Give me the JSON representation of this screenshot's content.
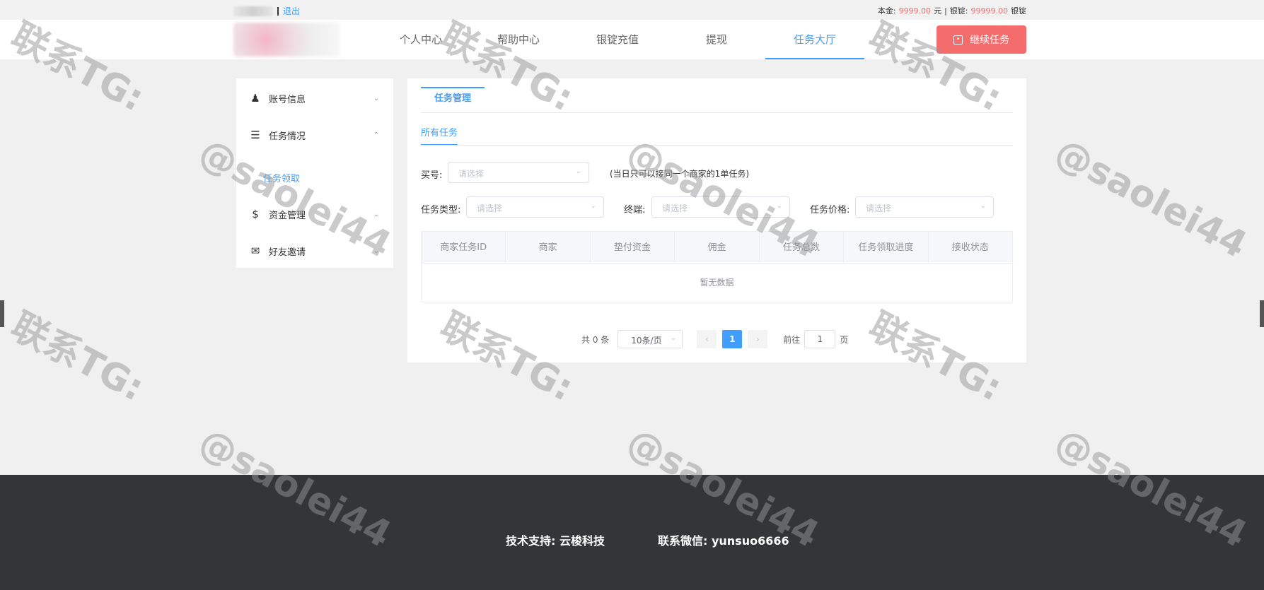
{
  "topbar": {
    "logout": "退出",
    "principal_label": "本金:",
    "principal_value": "9999.00",
    "principal_unit": "元",
    "divider": "|",
    "ingot_label": "银锭:",
    "ingot_value": "99999.00",
    "ingot_unit": "银锭"
  },
  "nav": {
    "items": [
      "个人中心",
      "帮助中心",
      "银锭充值",
      "提现",
      "任务大厅"
    ],
    "active": "任务大厅",
    "bell_icon": "bell-icon",
    "continue_button": "继续任务"
  },
  "sidebar": {
    "items": [
      {
        "label": "账号信息",
        "icon": "user-icon"
      },
      {
        "label": "任务情况",
        "icon": "list-icon"
      },
      {
        "label": "资金管理",
        "icon": "money-bag-icon"
      },
      {
        "label": "好友邀请",
        "icon": "envelope-icon"
      }
    ],
    "sub_item": "任务领取"
  },
  "main": {
    "tab_primary": "任务管理",
    "tab_secondary": "所有任务",
    "filters": {
      "buyer_label": "买号:",
      "buyer_placeholder": "请选择",
      "buyer_note": "(当日只可以接同一个商家的1单任务)",
      "type_label": "任务类型:",
      "type_placeholder": "请选择",
      "terminal_label": "终端:",
      "terminal_placeholder": "请选择",
      "price_label": "任务价格:",
      "price_placeholder": "请选择"
    },
    "table": {
      "columns": [
        "商家任务ID",
        "商家",
        "垫付资金",
        "佣金",
        "任务总数",
        "任务领取进度",
        "接收状态"
      ],
      "empty_text": "暂无数据"
    },
    "pagination": {
      "total": "共 0 条",
      "page_size": "10条/页",
      "current_page": "1",
      "goto_label": "前往",
      "goto_value": "1",
      "page_suffix": "页"
    }
  },
  "footer": {
    "support": "技术支持: 云梭科技",
    "wechat": "联系微信: yunsuo6666"
  },
  "watermark": {
    "line1": "联系TG:",
    "line2": "@saolei44"
  },
  "colors": {
    "accent": "#409eff",
    "danger": "#f56c6c",
    "footer_bg": "#333538"
  }
}
